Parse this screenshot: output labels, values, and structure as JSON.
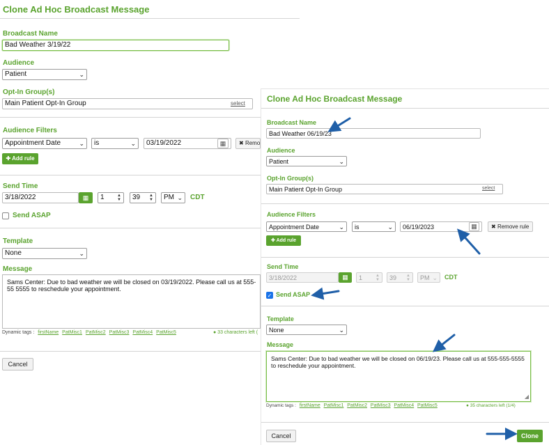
{
  "left": {
    "title": "Clone Ad Hoc Broadcast Message",
    "broadcast_name_label": "Broadcast Name",
    "broadcast_name_value": "Bad Weather 3/19/22",
    "audience_label": "Audience",
    "audience_value": "Patient",
    "optin_label": "Opt-In Group(s)",
    "optin_value": "Main Patient Opt-In Group",
    "optin_select_link": "select",
    "filters_label": "Audience Filters",
    "filter_field": "Appointment Date",
    "filter_operator": "is",
    "filter_date": "03/19/2022",
    "remove_rule_label": "Remo",
    "add_rule_label": "Add rule",
    "send_time_label": "Send Time",
    "send_date": "3/18/2022",
    "send_hour": "1",
    "send_minute": "39",
    "send_ampm": "PM",
    "timezone": "CDT",
    "send_asap_label": "Send ASAP",
    "template_label": "Template",
    "template_value": "None",
    "message_label": "Message",
    "message_text": "Sams Center: Due to bad weather we will be closed on 03/19/2022. Please call us at 555-55 5555 to reschedule your appointment.",
    "dynamic_tags_label": "Dynamic tags :",
    "dynamic_tags": [
      "firstName",
      "PatMisc1",
      "PatMisc2",
      "PatMisc3",
      "PatMisc4",
      "PatMisc5"
    ],
    "chars_left": "● 33 characters left (",
    "cancel_label": "Cancel"
  },
  "right": {
    "title": "Clone Ad Hoc Broadcast Message",
    "broadcast_name_label": "Broadcast Name",
    "broadcast_name_value": "Bad Weather 06/19/23",
    "audience_label": "Audience",
    "audience_value": "Patient",
    "optin_label": "Opt-In Group(s)",
    "optin_value": "Main Patient Opt-In Group",
    "optin_select_link": "select",
    "filters_label": "Audience Filters",
    "filter_field": "Appointment Date",
    "filter_operator": "is",
    "filter_date": "06/19/2023",
    "remove_rule_label": "Remove rule",
    "add_rule_label": "Add rule",
    "send_time_label": "Send Time",
    "send_date": "3/18/2022",
    "send_hour": "1",
    "send_minute": "39",
    "send_ampm": "PM",
    "timezone": "CDT",
    "send_asap_label": "Send ASAP",
    "template_label": "Template",
    "template_value": "None",
    "message_label": "Message",
    "message_text": "Sams Center: Due to bad weather we will be closed on 06/19/23. Please call us at 555-555-5555 to reschedule your appointment.",
    "dynamic_tags_label": "Dynamic tags :",
    "dynamic_tags": [
      "firstName",
      "PatMisc1",
      "PatMisc2",
      "PatMisc3",
      "PatMisc4",
      "PatMisc5"
    ],
    "chars_left": "● 35 characters left (1/4)",
    "cancel_label": "Cancel",
    "clone_label": "Clone"
  },
  "colors": {
    "accent": "#5aa32e",
    "annotation_arrow": "#1f5fa8"
  },
  "icons": {
    "calendar": "calendar-icon",
    "chevron": "chevron-down-icon",
    "plus": "plus-icon",
    "close": "close-icon",
    "check": "check-icon",
    "arrow": "annotation-arrow-icon"
  }
}
